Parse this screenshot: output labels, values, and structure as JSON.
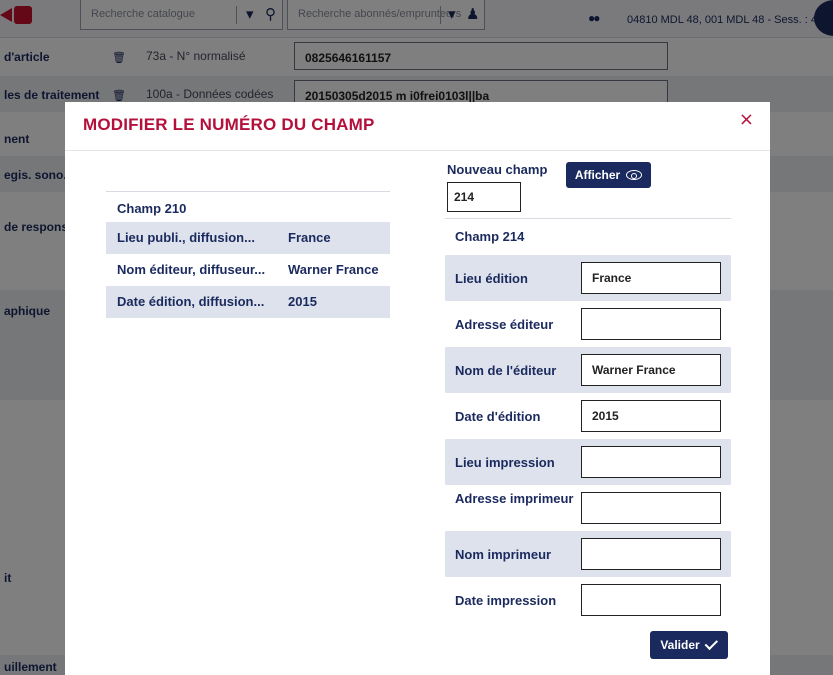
{
  "background": {
    "search_catalogue_placeholder": "Recherche catalogue",
    "search_readers_placeholder": "Recherche abonnés/emprunteurs",
    "session_info": "04810 MDL 48, 001 MDL 48 - Sess. : 4",
    "rows": [
      {
        "label": "d'article",
        "sub": "73a - N° normalisé",
        "value": "0825646161157"
      },
      {
        "label": "les de traitement",
        "sub": "100a - Données codées",
        "value": "20150305d2015    m  i0frei0103l||ba"
      },
      {
        "label": "nent",
        "sub": "",
        "value": ""
      },
      {
        "label": "egis. sono.",
        "sub": "",
        "value": ""
      },
      {
        "label": "de respons",
        "sub": "",
        "value": ""
      },
      {
        "label": "aphique",
        "sub": "",
        "value": ""
      },
      {
        "label": "it",
        "sub": "",
        "value": ""
      },
      {
        "label": "uillement",
        "sub": "",
        "value": ""
      }
    ]
  },
  "modal": {
    "title": "MODIFIER LE NUMÉRO DU CHAMP",
    "close_label": "×",
    "source": {
      "heading": "Champ 210",
      "rows": [
        {
          "label": "Lieu publi., diffusion...",
          "value": "France"
        },
        {
          "label": "Nom éditeur, diffuseur...",
          "value": "Warner France"
        },
        {
          "label": "Date édition, diffusion...",
          "value": "2015"
        }
      ]
    },
    "new_field": {
      "label": "Nouveau champ",
      "value": "214",
      "show_button": "Afficher"
    },
    "target": {
      "heading": "Champ 214",
      "rows": [
        {
          "label": "Lieu édition",
          "value": "France"
        },
        {
          "label": "Adresse éditeur",
          "value": ""
        },
        {
          "label": "Nom de l'éditeur",
          "value": "Warner France"
        },
        {
          "label": "Date d'édition",
          "value": "2015"
        },
        {
          "label": "Lieu impression",
          "value": ""
        },
        {
          "label": "Adresse imprimeur",
          "value": ""
        },
        {
          "label": "Nom imprimeur",
          "value": ""
        },
        {
          "label": "Date impression",
          "value": ""
        }
      ]
    },
    "submit_button": "Valider"
  },
  "colors": {
    "accent": "#b5103b",
    "primary": "#1b2a5e",
    "row_alt": "#dde2ec"
  }
}
